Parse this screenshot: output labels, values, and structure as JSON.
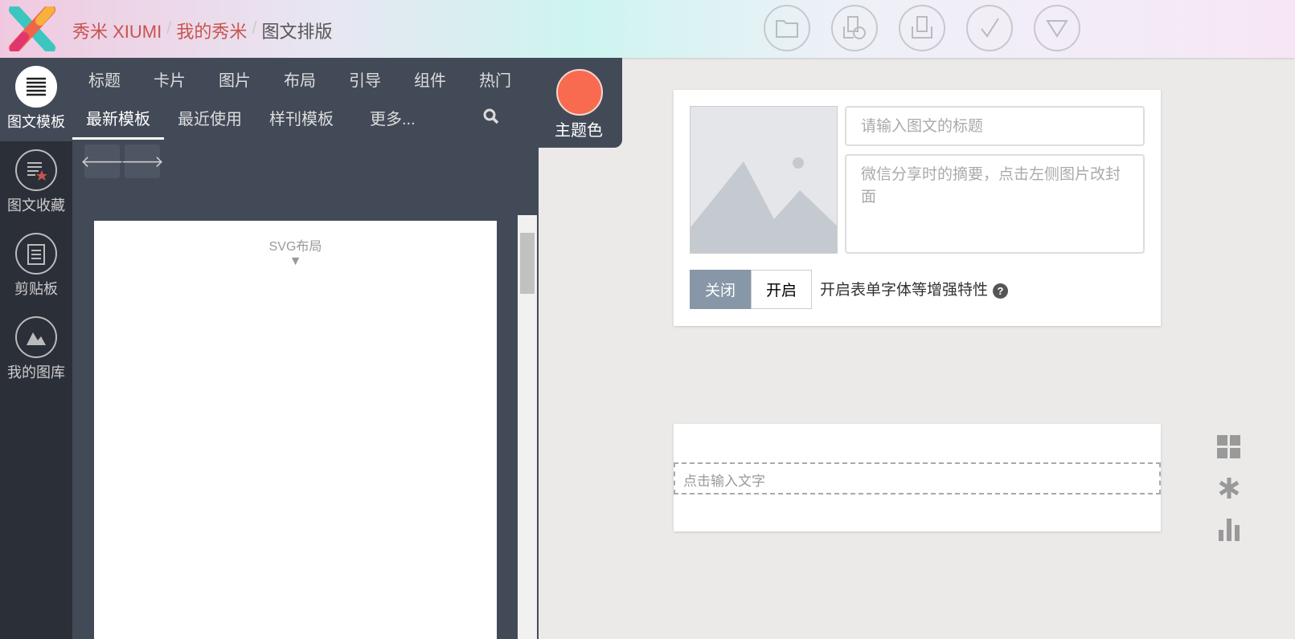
{
  "header": {
    "breadcrumbs": [
      "秀米 XIUMI",
      "我的秀米",
      "图文排版"
    ],
    "separator": "/",
    "toolbar_icons": [
      "folder-icon",
      "image-settings-icon",
      "print-icon",
      "check-icon",
      "triangle-down-icon"
    ]
  },
  "sidebar": {
    "items": [
      {
        "label": "图文模板",
        "icon": "list-icon"
      },
      {
        "label": "图文收藏",
        "icon": "favorites-icon"
      },
      {
        "label": "剪贴板",
        "icon": "clipboard-icon"
      },
      {
        "label": "我的图库",
        "icon": "gallery-icon"
      }
    ]
  },
  "panel": {
    "categories": [
      "标题",
      "卡片",
      "图片",
      "布局",
      "引导",
      "组件",
      "热门"
    ],
    "subtabs": [
      "最新模板",
      "最近使用",
      "样刊模板",
      "更多..."
    ],
    "theme_label": "主题色",
    "theme_color": "#f86b50",
    "preview_label": "SVG布局",
    "preview_arrow": "▼"
  },
  "editor": {
    "title_placeholder": "请输入图文的标题",
    "summary_placeholder": "微信分享时的摘要，点击左侧图片改封面",
    "toggle_off": "关闭",
    "toggle_on": "开启",
    "toggle_label": "开启表单字体等增强特性",
    "help": "?",
    "text_placeholder": "点击输入文字"
  }
}
